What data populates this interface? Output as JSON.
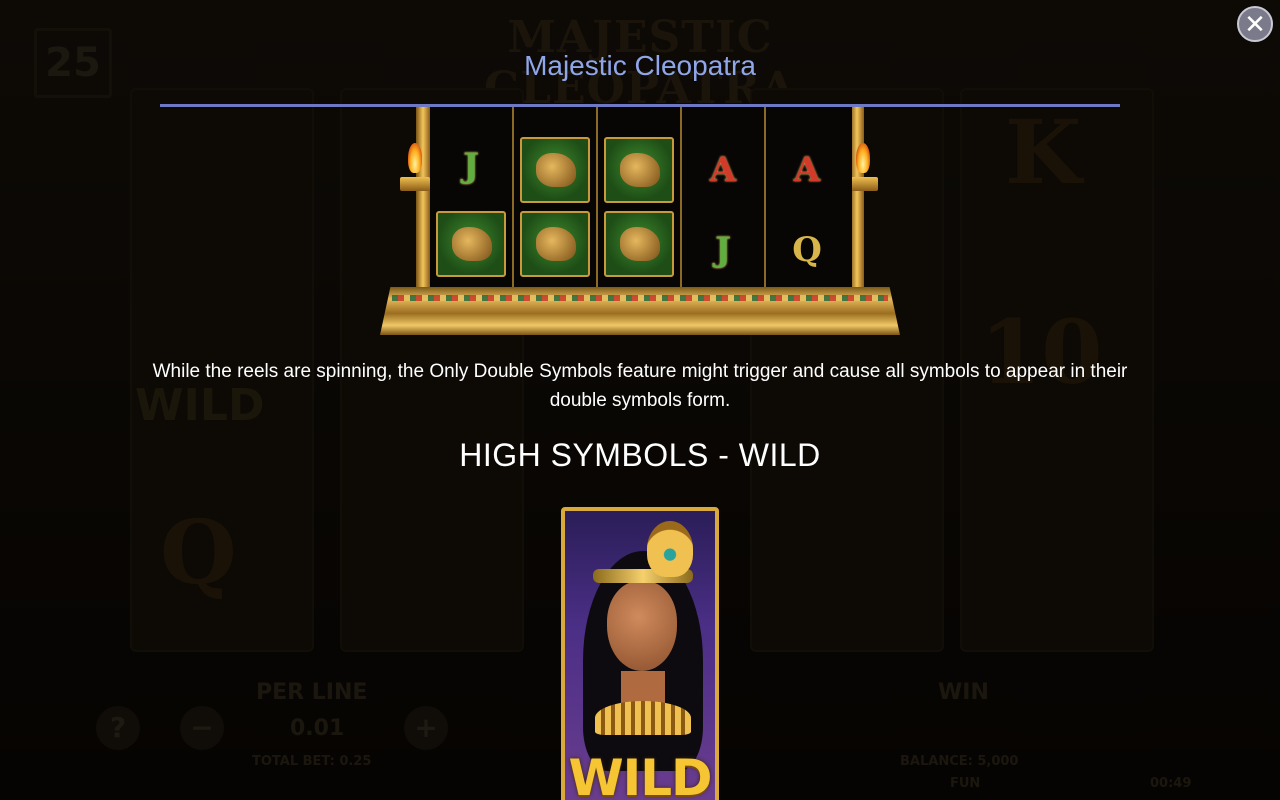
{
  "background": {
    "game_logo": "MAJESTIC CLEOPATRA",
    "lines_count": "25",
    "reel_letters": [
      "K",
      "Q",
      "10"
    ],
    "per_line_label": "PER LINE",
    "per_line_value": "0.01",
    "total_bet": "TOTAL BET: 0.25",
    "win_label": "WIN",
    "balance": "BALANCE: 5,000",
    "currency": "FUN",
    "clock": "00:49",
    "help_glyph": "?",
    "minus_glyph": "−",
    "plus_glyph": "+",
    "wild_text": "WILD"
  },
  "popup": {
    "title": "Majestic Cleopatra",
    "close_icon": "close-icon",
    "description": "While the reels are spinning, the Only Double Symbols feature might trigger and cause all symbols to appear in their double symbols form.",
    "section_title": "HIGH SYMBOLS - WILD",
    "wild_label": "WILD"
  },
  "colors": {
    "title": "#8fa6e8",
    "rule": "#6d79c4",
    "gold": "#d9a93c"
  },
  "reels_preview": [
    [
      "J",
      "camel"
    ],
    [
      "camel",
      "camel"
    ],
    [
      "camel",
      "camel"
    ],
    [
      "A",
      "J"
    ],
    [
      "A",
      "Q"
    ]
  ]
}
